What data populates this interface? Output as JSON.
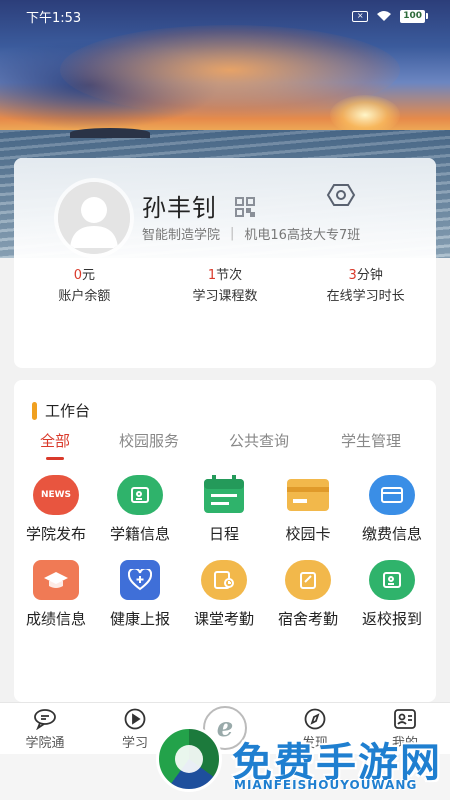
{
  "status_bar": {
    "time": "下午1:53",
    "sim_label": "×",
    "battery": "100"
  },
  "profile": {
    "name": "孙丰钊",
    "college": "智能制造学院",
    "class_name": "机电16高技大专7班"
  },
  "stats": [
    {
      "value": "0",
      "unit": "元",
      "label": "账户余额"
    },
    {
      "value": "1",
      "unit": "节次",
      "label": "学习课程数"
    },
    {
      "value": "3",
      "unit": "分钟",
      "label": "在线学习时长"
    }
  ],
  "workbench": {
    "title": "工作台",
    "tabs": [
      "全部",
      "校园服务",
      "公共查询",
      "学生管理"
    ],
    "active_tab": "全部",
    "apps": [
      {
        "label": "学院发布",
        "icon": "news-icon",
        "color": "#e8553f",
        "badge": "NEWS"
      },
      {
        "label": "学籍信息",
        "icon": "student-card-icon",
        "color": "#2fb36b"
      },
      {
        "label": "日程",
        "icon": "calendar-icon",
        "color": "#2fb36b"
      },
      {
        "label": "校园卡",
        "icon": "campus-card-icon",
        "color": "#f2b84b"
      },
      {
        "label": "缴费信息",
        "icon": "payment-card-icon",
        "color": "#3a8ee6"
      },
      {
        "label": "成绩信息",
        "icon": "graduation-cap-icon",
        "color": "#f07a55"
      },
      {
        "label": "健康上报",
        "icon": "health-heart-icon",
        "color": "#3f6fd8"
      },
      {
        "label": "课堂考勤",
        "icon": "attendance-clock-icon",
        "color": "#f2b84b"
      },
      {
        "label": "宿舍考勤",
        "icon": "dorm-checkin-icon",
        "color": "#f2b84b"
      },
      {
        "label": "返校报到",
        "icon": "return-report-icon",
        "color": "#2fb36b"
      }
    ]
  },
  "bottom_nav": [
    {
      "label": "学院通",
      "icon": "chat-bubble-icon"
    },
    {
      "label": "学习",
      "icon": "play-circle-icon"
    },
    {
      "label": "",
      "icon": "center-logo-icon"
    },
    {
      "label": "发现",
      "icon": "compass-icon"
    },
    {
      "label": "我的",
      "icon": "profile-card-icon"
    }
  ],
  "center_logo_letter": "e",
  "watermark": {
    "title": "免费手游网",
    "subtitle": "MIANFEISHOUYOUWANG"
  }
}
